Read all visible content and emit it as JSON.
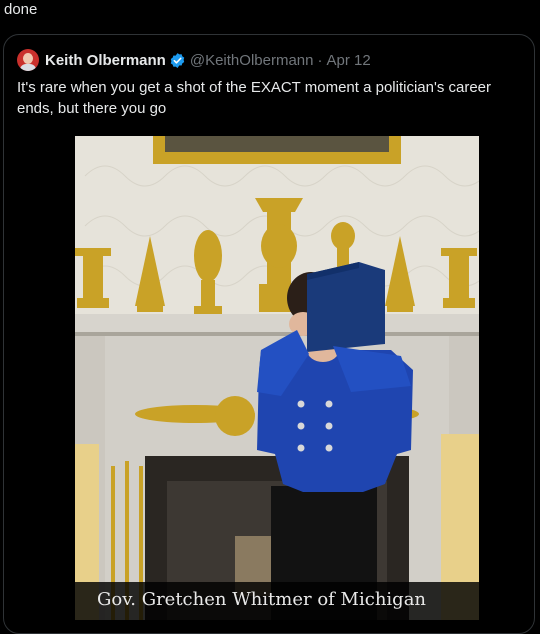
{
  "top_text": "done",
  "quote": {
    "author_name": "Keith Olbermann",
    "handle": "@KeithOlbermann",
    "separator": "·",
    "date": "Apr 12",
    "text": "It's rare when you get a shot of the EXACT moment a politician's career ends, but there you go",
    "avatar_icon": "profile-avatar",
    "verified_icon": "verified-badge-icon",
    "verified_color": "#1d9bf0"
  },
  "photo": {
    "caption": "Gov. Gretchen Whitmer of Michigan",
    "colors": {
      "jacket": "#1f45b0",
      "folder": "#1a3a7a",
      "gold": "#c9a227",
      "wall": "#e6e3da",
      "mantel": "#d7d4cd"
    }
  }
}
